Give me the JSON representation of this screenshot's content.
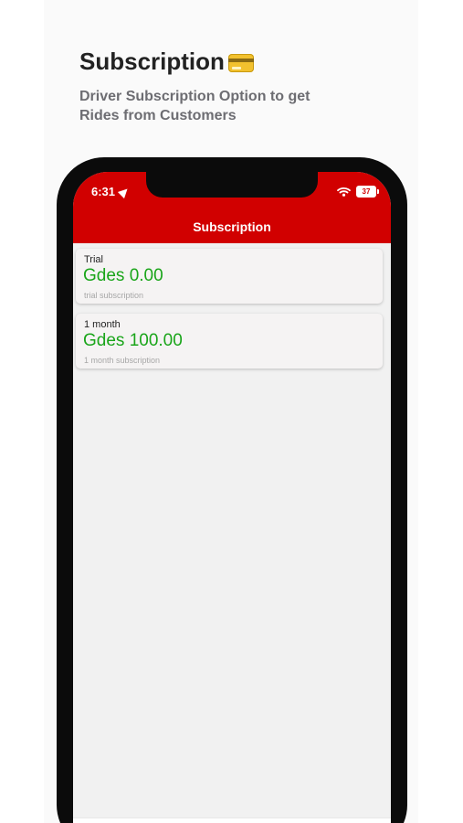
{
  "promo": {
    "title": "Subscription",
    "title_icon": "credit-card-icon",
    "subtitle": "Driver Subscription Option to get Rides from Customers"
  },
  "status_bar": {
    "time": "6:31",
    "battery": "37",
    "location_icon": "location-arrow-icon",
    "wifi_icon": "wifi-icon"
  },
  "header": {
    "title": "Subscription",
    "bg_color": "#d10000"
  },
  "subscriptions": [
    {
      "name": "Trial",
      "price": "Gdes 0.00",
      "description": "trial subscription"
    },
    {
      "name": "1 month",
      "price": "Gdes 100.00",
      "description": "1 month subscription"
    }
  ],
  "tabbar": {
    "items": [
      {
        "icon": "home-icon",
        "active": false
      },
      {
        "icon": "list-icon",
        "active": false
      },
      {
        "icon": "wallet-icon",
        "active": false
      },
      {
        "icon": "subscription-archive-icon",
        "active": true
      },
      {
        "icon": "settings-gear-icon",
        "active": false
      }
    ],
    "active_color": "#d10000",
    "inactive_color": "#444444"
  },
  "colors": {
    "price_green": "#1aa51a",
    "screen_bg": "#f1f1f1"
  }
}
